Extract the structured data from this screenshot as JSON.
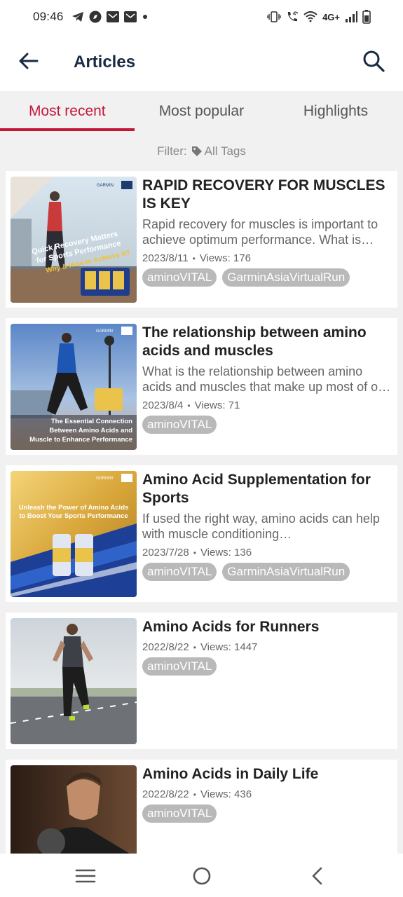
{
  "status_bar": {
    "time": "09:46",
    "network": "4G+",
    "icons_left": [
      "telegram-icon",
      "compass-icon",
      "mail-icon",
      "mail-icon",
      "dot-icon"
    ],
    "icons_right": [
      "vibrate-icon",
      "wifi-call-icon",
      "wifi-icon",
      "signal-icon",
      "battery-icon"
    ]
  },
  "app_bar": {
    "title": "Articles"
  },
  "tabs": [
    {
      "label": "Most recent",
      "active": true
    },
    {
      "label": "Most popular",
      "active": false
    },
    {
      "label": "Highlights",
      "active": false
    }
  ],
  "filter": {
    "label": "Filter:",
    "value": "All Tags"
  },
  "articles": [
    {
      "title": "RAPID RECOVERY FOR MUSCLES IS KEY",
      "excerpt": "Rapid recovery for muscles is important to achieve optimum performance. What is rapid recovery for muscles? And what can one do to achieve it?",
      "date": "2023/8/11",
      "views": "Views: 176",
      "tags": [
        "aminoVITAL",
        "GarminAsiaVirtualRun"
      ],
      "thumb_text": {
        "brand": "GARMIN",
        "line1": "Quick Recovery Matters",
        "line2": "for Sports Performance",
        "line3": "Why & How to Achieve It?"
      }
    },
    {
      "title": "The relationship between amino acids and muscles",
      "excerpt": "What is the relationship between amino acids and muscles that make up most of our body?",
      "date": "2023/8/4",
      "views": "Views: 71",
      "tags": [
        "aminoVITAL"
      ],
      "thumb_text": {
        "brand": "GARMIN",
        "line1": "The Essential Connection",
        "line2": "Between Amino Acids and",
        "line3": "Muscle to Enhance Performance"
      }
    },
    {
      "title": "Amino Acid Supplementation for Sports",
      "excerpt": "If used the right way, amino acids can help with muscle conditioning…",
      "date": "2023/7/28",
      "views": "Views: 136",
      "tags": [
        "aminoVITAL",
        "GarminAsiaVirtualRun"
      ],
      "thumb_text": {
        "brand": "GARMIN",
        "line1": "Unleash the Power of Amino Acids",
        "line2": "to Boost Your Sports Performance",
        "line3": ""
      }
    },
    {
      "title": "Amino Acids for Runners",
      "excerpt": "",
      "date": "2022/8/22",
      "views": "Views: 1447",
      "tags": [
        "aminoVITAL"
      ],
      "thumb_text": {
        "brand": "",
        "line1": "",
        "line2": "",
        "line3": ""
      }
    },
    {
      "title": "Amino Acids in Daily Life",
      "excerpt": "",
      "date": "2022/8/22",
      "views": "Views: 436",
      "tags": [
        "aminoVITAL"
      ],
      "thumb_text": {
        "brand": "",
        "line1": "",
        "line2": "",
        "line3": ""
      }
    }
  ],
  "nav_bar": {
    "buttons": [
      "recents-icon",
      "home-icon",
      "back-icon"
    ]
  },
  "colors": {
    "accent": "#c4163a",
    "title_dark": "#1a2a44",
    "chip_bg": "#b9b9b9"
  }
}
